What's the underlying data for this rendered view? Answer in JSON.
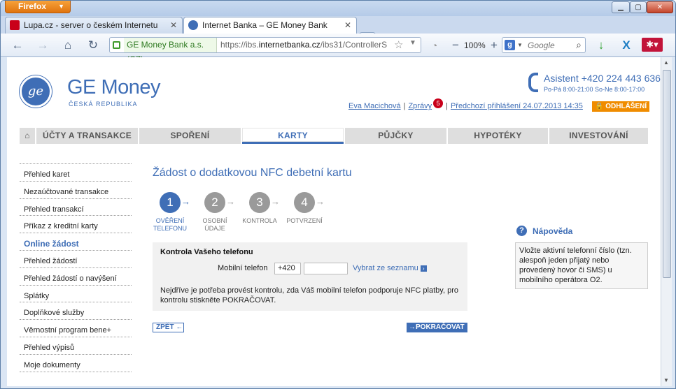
{
  "browser": {
    "app_button": "Firefox",
    "tabs": [
      {
        "title": "Lupa.cz - server o českém Internetu"
      },
      {
        "title": "Internet Banka – GE Money Bank"
      }
    ],
    "identity": "GE Money Bank a.s. (CZ)",
    "url_prefix": "https://ibs.",
    "url_host": "internetbanka.cz",
    "url_rest": "/ibs31/ControllerS",
    "zoom": "100%",
    "search_placeholder": "Google"
  },
  "header": {
    "brand": "GE Money",
    "brand_sub": "ČESKÁ REPUBLIKA",
    "assist": "Asistent +420 224 443 636",
    "hours": "Po-Pá 8:00-21:00 So-Ne 8:00-17:00",
    "user": "Eva Macichová",
    "messages": "Zprávy",
    "messages_count": "5",
    "last_login": "Předchozí přihlášení 24.07.2013 14:35",
    "logout": "ODHLÁŠENÍ"
  },
  "menu": [
    "ÚČTY A TRANSAKCE",
    "SPOŘENÍ",
    "KARTY",
    "PŮJČKY",
    "HYPOTÉKY",
    "INVESTOVÁNÍ"
  ],
  "menu_active": "KARTY",
  "sidebar": [
    "Přehled karet",
    "Nezaúčtované transakce",
    "Přehled transakcí",
    "Příkaz z kreditní karty",
    "Online žádost",
    "Přehled žádostí",
    "Přehled žádostí o navýšení",
    "Splátky",
    "Doplňkové služby",
    "Věrnostní program bene+",
    "Přehled výpisů",
    "Moje dokumenty"
  ],
  "sidebar_selected": "Online žádost",
  "page": {
    "title": "Žádost o dodatkovou NFC debetní kartu",
    "steps": [
      {
        "num": "1",
        "line1": "OVĚŘENÍ",
        "line2": "TELEFONU"
      },
      {
        "num": "2",
        "line1": "OSOBNÍ",
        "line2": "ÚDAJE"
      },
      {
        "num": "3",
        "line1": "KONTROLA",
        "line2": ""
      },
      {
        "num": "4",
        "line1": "POTVRZENÍ",
        "line2": ""
      }
    ],
    "active_step": 1,
    "form_title": "Kontrola Vašeho telefonu",
    "phone_label": "Mobilní telefon",
    "phone_prefix": "+420",
    "phone_value": "",
    "pick_link": "Vybrat ze seznamu",
    "note": "Nejdříve je potřeba provést kontrolu, zda Váš mobilní telefon podporuje NFC platby, pro kontrolu stiskněte POKRAČOVAT.",
    "back": "ZPĚT",
    "continue": "POKRAČOVAT"
  },
  "help": {
    "title": "Nápověda",
    "text": "Vložte aktivní telefonní číslo (tzn. alespoň jeden přijatý nebo provedený hovor či SMS) u mobilního operátora O2."
  },
  "colors": {
    "brand": "#3f6eb6",
    "logout": "#f08c00",
    "badge": "#c9001a",
    "firefox": "#e87d16"
  }
}
